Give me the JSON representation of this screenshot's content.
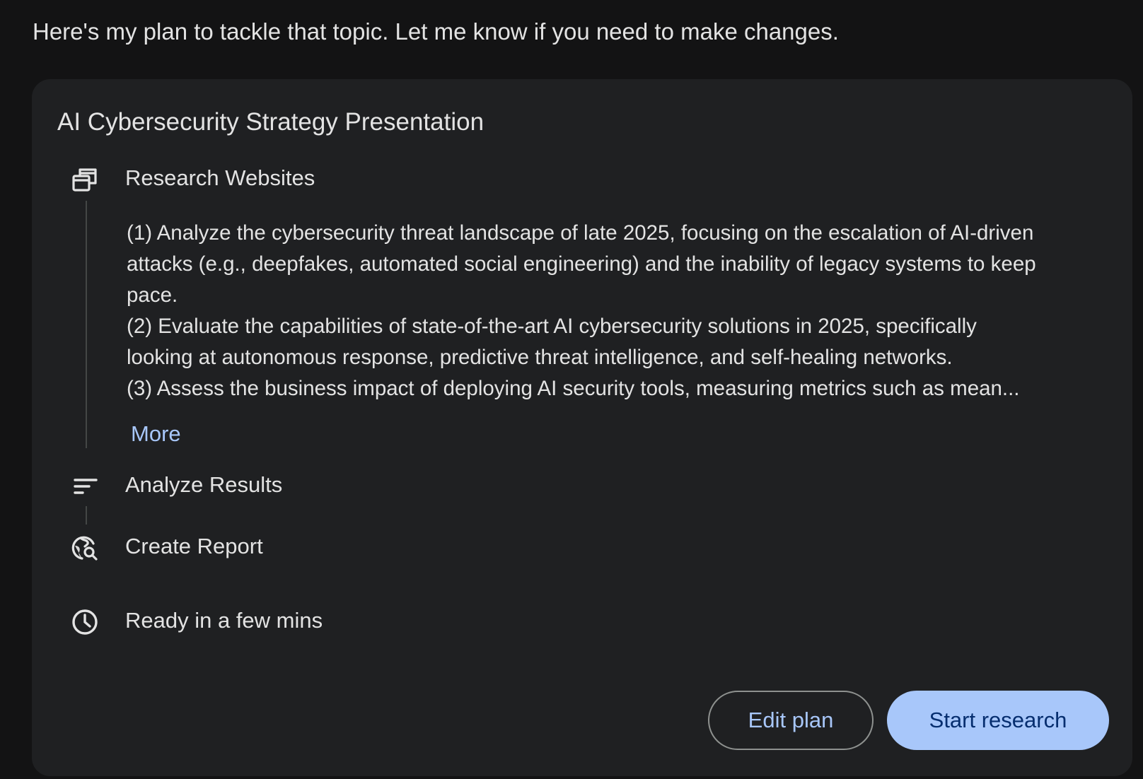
{
  "intro_text": "Here's my plan to tackle that topic. Let me know if you need to make changes.",
  "card": {
    "title": "AI Cybersecurity Strategy Presentation",
    "steps": [
      {
        "label": "Research Websites",
        "icon": "browser-windows-icon"
      },
      {
        "label": "Analyze Results",
        "icon": "sort-lines-icon"
      },
      {
        "label": "Create Report",
        "icon": "globe-search-icon"
      }
    ],
    "research_lines": [
      "(1) Analyze the cybersecurity threat landscape of late 2025, focusing on the escalation of AI-driven",
      "attacks (e.g., deepfakes, automated social engineering) and the inability of legacy systems to keep",
      "pace.",
      "(2) Evaluate the capabilities of state-of-the-art AI cybersecurity solutions in 2025, specifically",
      "looking at autonomous response, predictive threat intelligence, and self-healing networks.",
      "(3) Assess the business impact of deploying AI security tools, measuring metrics such as mean..."
    ],
    "more_label": "More",
    "eta_text": "Ready in a few mins",
    "edit_button": "Edit plan",
    "start_button": "Start research"
  },
  "colors": {
    "page_bg": "#131314",
    "card_bg": "#1f2022",
    "text": "#e3e3e3",
    "accent": "#a8c7fa",
    "primary_button_text": "#062e6f"
  }
}
